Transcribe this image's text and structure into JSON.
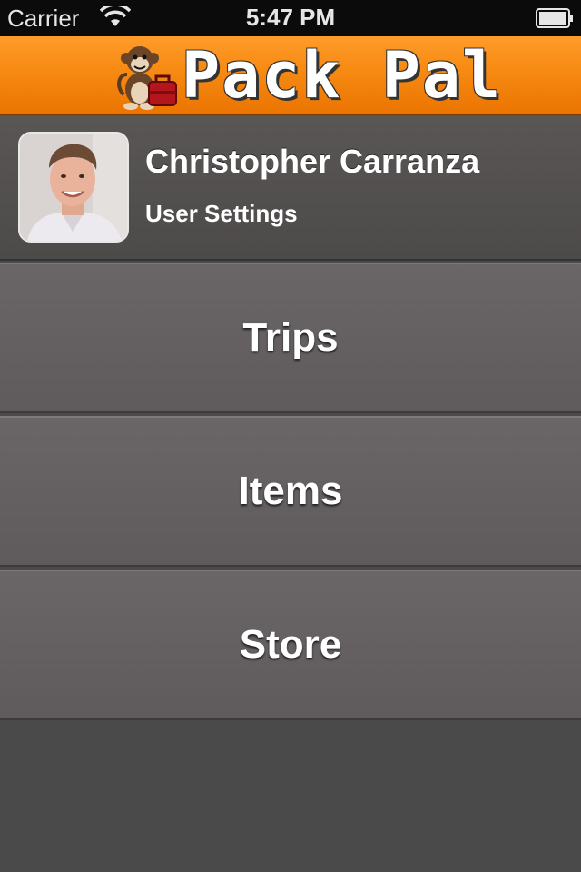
{
  "status_bar": {
    "carrier": "Carrier",
    "time": "5:47 PM"
  },
  "header": {
    "logo_text": "Pack Pal",
    "accent_color": "#f68a12"
  },
  "profile": {
    "name": "Christopher Carranza",
    "settings_label": "User Settings"
  },
  "menu": {
    "items": [
      {
        "label": "Trips"
      },
      {
        "label": "Items"
      },
      {
        "label": "Store"
      }
    ]
  },
  "icons": [
    "wifi-icon",
    "battery-icon",
    "monkey-mascot-icon",
    "avatar-photo"
  ]
}
